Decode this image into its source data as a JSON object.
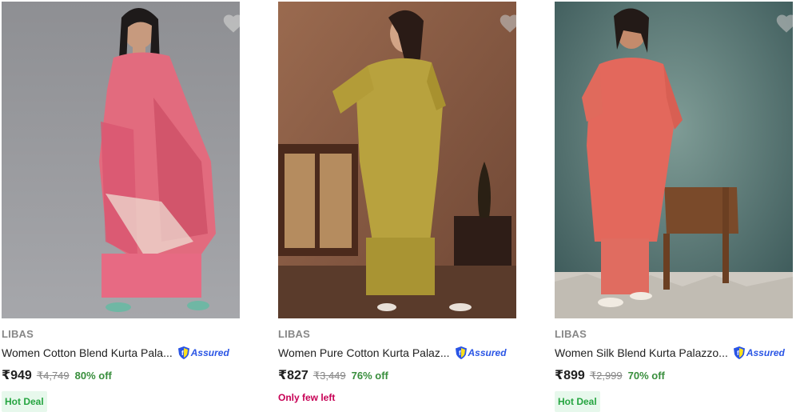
{
  "cut_text": "",
  "products": [
    {
      "brand": "LIBAS",
      "title": "Women Cotton Blend Kurta Pala...",
      "assured": "Assured",
      "price": "₹949",
      "mrp": "₹4,749",
      "discount": "80% off",
      "tag": "Hot Deal",
      "tag_type": "deal",
      "image_icon": "product-photo-pink-kurta-set"
    },
    {
      "brand": "LIBAS",
      "title": "Women Pure Cotton Kurta Palaz...",
      "assured": "Assured",
      "price": "₹827",
      "mrp": "₹3,449",
      "discount": "76% off",
      "tag": "Only few left",
      "tag_type": "few",
      "image_icon": "product-photo-olive-kurta-set"
    },
    {
      "brand": "LIBAS",
      "title": "Women Silk Blend Kurta Palazzo...",
      "assured": "Assured",
      "price": "₹899",
      "mrp": "₹2,999",
      "discount": "70% off",
      "tag": "Hot Deal",
      "tag_type": "deal",
      "image_icon": "product-photo-coral-kurta-set"
    }
  ],
  "colors": {
    "price_off": "#388e3c",
    "hot_deal_text": "#26a541",
    "hot_deal_bg": "#e7f8ec",
    "few_left": "#c70055",
    "assured": "#2a55e5"
  }
}
